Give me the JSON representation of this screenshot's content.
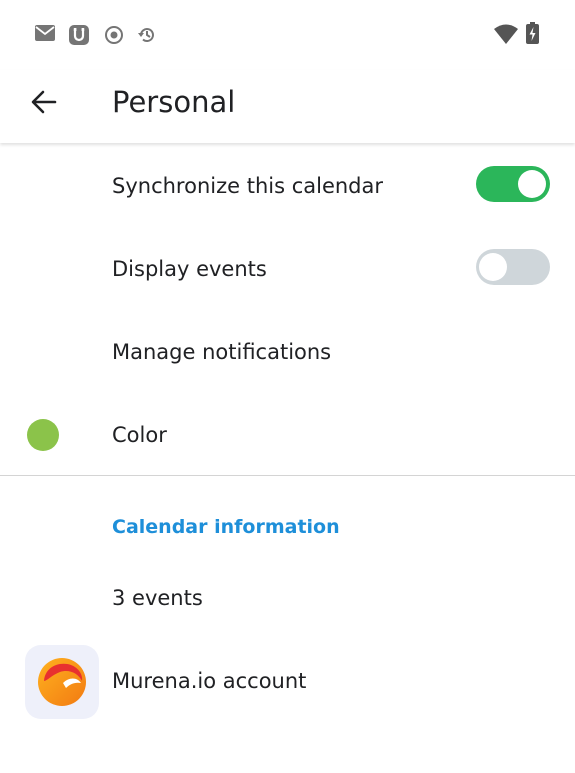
{
  "status_bar": {
    "left_icons": [
      "mail-icon",
      "magnet-icon",
      "record-icon",
      "sync-history-icon"
    ],
    "right_icons": [
      "wifi-icon",
      "battery-charging-icon"
    ]
  },
  "app_bar": {
    "back_icon": "arrow-back-icon",
    "title": "Personal"
  },
  "settings": {
    "sync": {
      "label": "Synchronize this calendar",
      "enabled": true
    },
    "display_events": {
      "label": "Display events",
      "enabled": false
    },
    "notifications": {
      "label": "Manage notifications"
    },
    "color": {
      "label": "Color",
      "value": "#8bc34a"
    }
  },
  "info": {
    "header": "Calendar information",
    "event_count": "3 events",
    "account": {
      "label": "Murena.io account",
      "icon": "murena-logo-icon"
    }
  },
  "colors": {
    "accent": "#1e8fd9",
    "switch_on": "#2bb65a",
    "switch_off": "#cfd6da"
  }
}
